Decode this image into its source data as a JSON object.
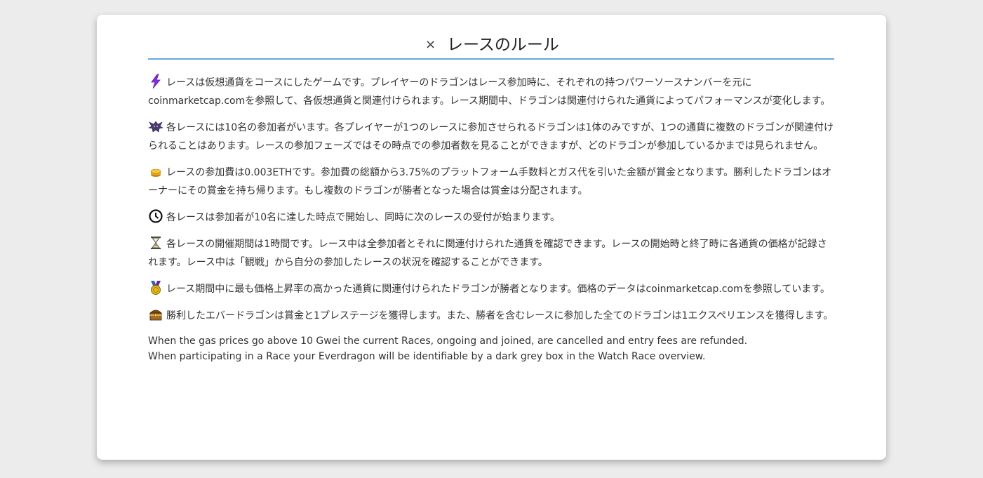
{
  "modal": {
    "title": "レースのルール",
    "close_label": "×"
  },
  "rules": [
    {
      "icon": "lightning-icon",
      "text": "レースは仮想通貨をコースにしたゲームです。プレイヤーのドラゴンはレース参加時に、それぞれの持つパワーソースナンバーを元にcoinmarketcap.comを参照して、各仮想通貨と関連付けられます。レース期間中、ドラゴンは関連付けられた通貨によってパフォーマンスが変化します。"
    },
    {
      "icon": "dragon-icon",
      "text": "各レースには10名の参加者がいます。各プレイヤーが1つのレースに参加させられるドラゴンは1体のみですが、1つの通貨に複数のドラゴンが関連付けられることはあります。レースの参加フェーズではその時点での参加者数を見ることができますが、どのドラゴンが参加しているかまでは見られません。"
    },
    {
      "icon": "coin-icon",
      "text": "レースの参加費は0.003ETHです。参加費の総額から3.75%のプラットフォーム手数料とガス代を引いた金額が賞金となります。勝利したドラゴンはオーナーにその賞金を持ち帰ります。もし複数のドラゴンが勝者となった場合は賞金は分配されます。"
    },
    {
      "icon": "clock-icon",
      "text": "各レースは参加者が10名に達した時点で開始し、同時に次のレースの受付が始まります。"
    },
    {
      "icon": "hourglass-icon",
      "text": "各レースの開催期間は1時間です。レース中は全参加者とそれに関連付けられた通貨を確認できます。レースの開始時と終了時に各通貨の価格が記録されます。レース中は「観戦」から自分の参加したレースの状況を確認することができます。"
    },
    {
      "icon": "medal-icon",
      "text": "レース期間中に最も価格上昇率の高かった通貨に関連付けられたドラゴンが勝者となります。価格のデータはcoinmarketcap.comを参照しています。"
    },
    {
      "icon": "treasure-chest-icon",
      "text": "勝利したエバードラゴンは賞金と1プレステージを獲得します。また、勝者を含むレースに参加した全てのドラゴンは1エクスペリエンスを獲得します。"
    }
  ],
  "notes": [
    "When the gas prices go above 10 Gwei the current Races, ongoing and joined, are cancelled and entry fees are refunded.",
    "When participating in a Race your Everdragon will be identifiable by a dark grey box in the Watch Race overview."
  ],
  "colors": {
    "header_rule": "#6aa8e0",
    "background": "#ececec",
    "modal": "#ffffff"
  }
}
